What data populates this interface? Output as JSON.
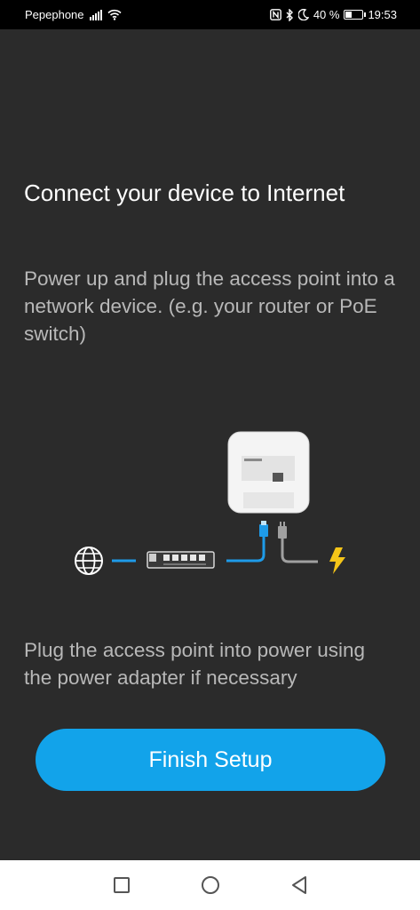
{
  "status_bar": {
    "carrier": "Pepephone",
    "battery_percent": "40 %",
    "battery_level": 0.4,
    "time": "19:53",
    "icons": [
      "signal-icon",
      "wifi-icon",
      "nfc-icon",
      "bluetooth-icon",
      "moon-icon",
      "battery-icon"
    ]
  },
  "main": {
    "title": "Connect your device to Internet",
    "description": "Power up and plug the access point into a network device. (e.g. your router or PoE switch)",
    "power_note": "Plug the access point into power using the power adapter if necessary",
    "finish_button": "Finish Setup",
    "diagram_icons": [
      "globe-icon",
      "network-switch-icon",
      "access-point-icon",
      "ethernet-plug-icon",
      "power-plug-icon",
      "lightning-icon"
    ]
  },
  "nav_bar": {
    "buttons": [
      "recents-button",
      "home-button",
      "back-button"
    ]
  },
  "colors": {
    "background": "#2b2b2b",
    "accent": "#12a3ea",
    "cable_blue": "#1e9be8",
    "lightning": "#f5c518"
  }
}
